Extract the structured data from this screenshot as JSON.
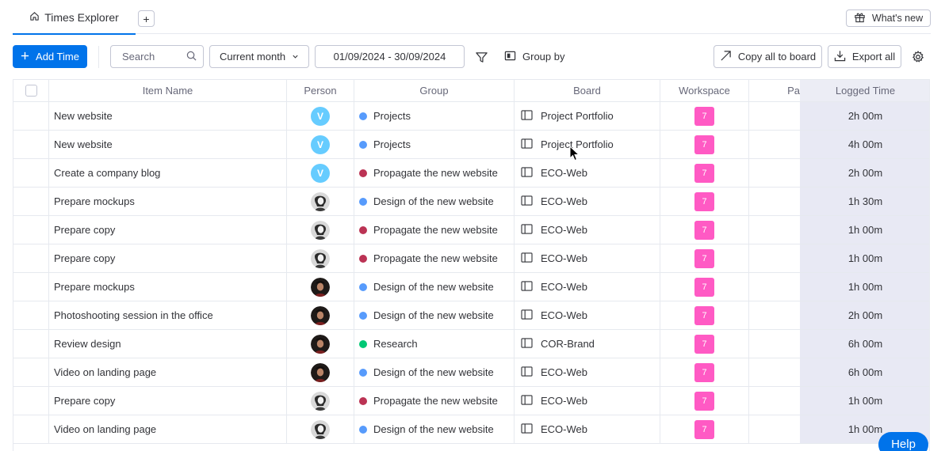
{
  "tabs": {
    "active_label": "Times Explorer",
    "add_label": "+",
    "whats_new_label": "What's new"
  },
  "toolbar": {
    "add_time_label": "Add Time",
    "search_placeholder": "Search",
    "period_label": "Current month",
    "date_range": "01/09/2024 - 30/09/2024",
    "group_by_label": "Group by",
    "copy_all_label": "Copy all to board",
    "export_all_label": "Export all"
  },
  "table": {
    "headers": {
      "item": "Item Name",
      "person": "Person",
      "group": "Group",
      "board": "Board",
      "workspace": "Workspace",
      "pa": "Pa",
      "logged": "Logged Time"
    },
    "rows": [
      {
        "item": "New website",
        "person": "V",
        "person_type": "letter",
        "group": "Projects",
        "group_color": "#579bfc",
        "board": "Project Portfolio",
        "workspace": "7",
        "logged": "2h 00m"
      },
      {
        "item": "New website",
        "person": "V",
        "person_type": "letter",
        "group": "Projects",
        "group_color": "#579bfc",
        "board": "Project Portfolio",
        "workspace": "7",
        "logged": "4h 00m"
      },
      {
        "item": "Create a company blog",
        "person": "V",
        "person_type": "letter",
        "group": "Propagate the new website",
        "group_color": "#bb3354",
        "board": "ECO-Web",
        "workspace": "7",
        "logged": "2h 00m"
      },
      {
        "item": "Prepare mockups",
        "person": "",
        "person_type": "photo-light",
        "group": "Design of the new website",
        "group_color": "#579bfc",
        "board": "ECO-Web",
        "workspace": "7",
        "logged": "1h 30m"
      },
      {
        "item": "Prepare copy",
        "person": "",
        "person_type": "photo-light",
        "group": "Propagate the new website",
        "group_color": "#bb3354",
        "board": "ECO-Web",
        "workspace": "7",
        "logged": "1h 00m"
      },
      {
        "item": "Prepare copy",
        "person": "",
        "person_type": "photo-light",
        "group": "Propagate the new website",
        "group_color": "#bb3354",
        "board": "ECO-Web",
        "workspace": "7",
        "logged": "1h 00m"
      },
      {
        "item": "Prepare mockups",
        "person": "",
        "person_type": "photo-dark",
        "group": "Design of the new website",
        "group_color": "#579bfc",
        "board": "ECO-Web",
        "workspace": "7",
        "logged": "1h 00m"
      },
      {
        "item": "Photoshooting session in the office",
        "person": "",
        "person_type": "photo-dark",
        "group": "Design of the new website",
        "group_color": "#579bfc",
        "board": "ECO-Web",
        "workspace": "7",
        "logged": "2h 00m"
      },
      {
        "item": "Review design",
        "person": "",
        "person_type": "photo-dark",
        "group": "Research",
        "group_color": "#00c875",
        "board": "COR-Brand",
        "workspace": "7",
        "logged": "6h 00m"
      },
      {
        "item": "Video on landing page",
        "person": "",
        "person_type": "photo-dark",
        "group": "Design of the new website",
        "group_color": "#579bfc",
        "board": "ECO-Web",
        "workspace": "7",
        "logged": "6h 00m"
      },
      {
        "item": "Prepare copy",
        "person": "",
        "person_type": "photo-light",
        "group": "Propagate the new website",
        "group_color": "#bb3354",
        "board": "ECO-Web",
        "workspace": "7",
        "logged": "1h 00m"
      },
      {
        "item": "Video on landing page",
        "person": "",
        "person_type": "photo-light",
        "group": "Design of the new website",
        "group_color": "#579bfc",
        "board": "ECO-Web",
        "workspace": "7",
        "logged": "1h 00m"
      }
    ]
  },
  "help_label": "Help",
  "colors": {
    "primary": "#0073ea",
    "workspace_badge": "#ff5ac4",
    "logged_column_bg": "#e8e9f4"
  }
}
